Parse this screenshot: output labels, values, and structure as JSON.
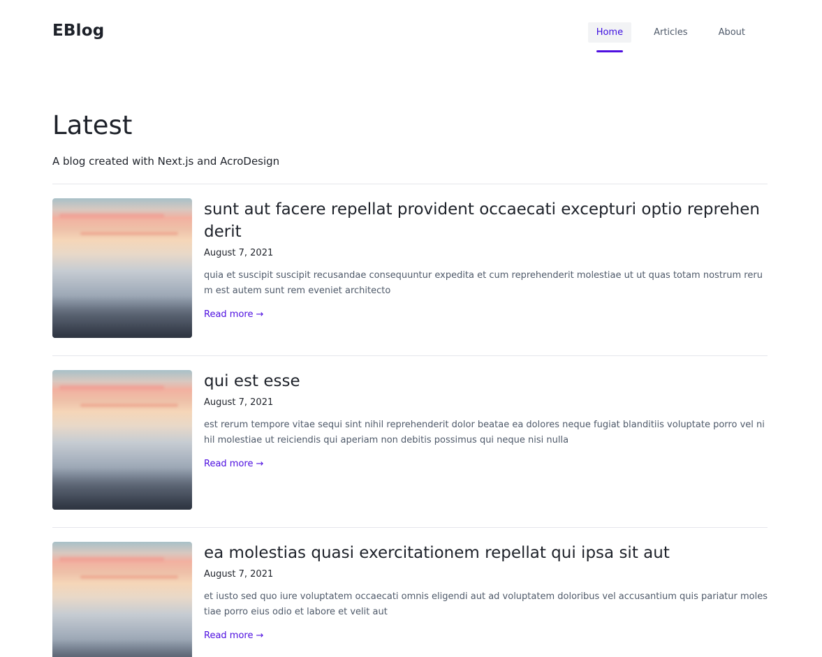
{
  "brand": {
    "name": "EBlog"
  },
  "nav": {
    "items": [
      {
        "label": "Home",
        "active": true
      },
      {
        "label": "Articles",
        "active": false
      },
      {
        "label": "About",
        "active": false
      }
    ]
  },
  "hero": {
    "title": "Latest",
    "subtitle": "A blog created with Next.js and AcroDesign"
  },
  "posts": [
    {
      "title": "sunt aut facere repellat provident occaecati excepturi optio reprehenderit",
      "date": "August 7, 2021",
      "excerpt": "quia et suscipit suscipit recusandae consequuntur expedita et cum reprehenderit molestiae ut ut quas totam nostrum rerum est autem sunt rem eveniet architecto",
      "read_more": "Read more",
      "arrow": "→"
    },
    {
      "title": "qui est esse",
      "date": "August 7, 2021",
      "excerpt": "est rerum tempore vitae sequi sint nihil reprehenderit dolor beatae ea dolores neque fugiat blanditiis voluptate porro vel nihil molestiae ut reiciendis qui aperiam non debitis possimus qui neque nisi nulla",
      "read_more": "Read more",
      "arrow": "→"
    },
    {
      "title": "ea molestias quasi exercitationem repellat qui ipsa sit aut",
      "date": "August 7, 2021",
      "excerpt": "et iusto sed quo iure voluptatem occaecati omnis eligendi aut ad voluptatem doloribus vel accusantium quis pariatur molestiae porro eius odio et labore et velit aut",
      "read_more": "Read more",
      "arrow": "→"
    }
  ],
  "colors": {
    "accent": "#4e0fe0",
    "nav_active_bg": "#f2f3f5",
    "text": "#1d2129",
    "muted": "#4e5969",
    "divider": "#e5e6eb"
  },
  "icons": {
    "read_more_arrow": "arrow-right-icon",
    "thumbnail": "sunset-sea-thumbnail"
  }
}
